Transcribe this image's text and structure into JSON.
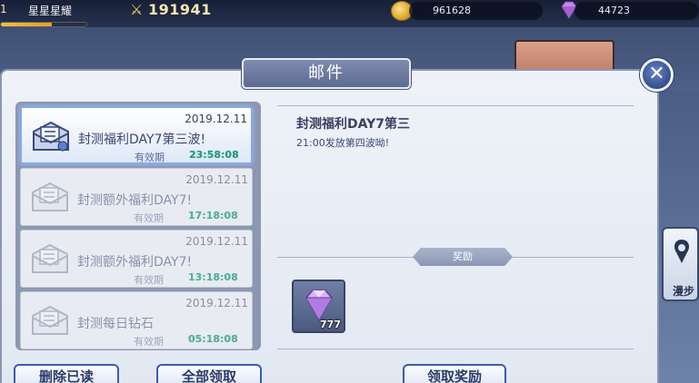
{
  "hud": {
    "level": "1",
    "player_name": "星星星耀",
    "exp_fraction": 0.6,
    "power_icon": "crossed-swords-icon",
    "power": "191941",
    "gold": "961628",
    "gems": "44723"
  },
  "side": {
    "button_label": "漫步"
  },
  "mail": {
    "title": "邮件",
    "items": [
      {
        "date": "2019.12.11",
        "subject": "封测福利DAY7第三波!",
        "valid_label": "有效期",
        "timer": "23:58:08",
        "active": true
      },
      {
        "date": "2019.12.11",
        "subject": "封测额外福利DAY7!",
        "valid_label": "有效期",
        "timer": "17:18:08",
        "active": false
      },
      {
        "date": "2019.12.11",
        "subject": "封测额外福利DAY7!",
        "valid_label": "有效期",
        "timer": "13:18:08",
        "active": false
      },
      {
        "date": "2019.12.11",
        "subject": "封测每日钻石",
        "valid_label": "有效期",
        "timer": "05:18:08",
        "active": false
      }
    ],
    "detail": {
      "title": "封测福利DAY7第三",
      "body": "21:00发放第四波呦!",
      "reward_label": "奖励",
      "reward": {
        "icon": "diamond-icon",
        "quantity": "777"
      }
    },
    "buttons": {
      "delete_read": "删除已读",
      "claim_all": "全部领取",
      "claim_reward": "领取奖励"
    }
  },
  "colors": {
    "accent": "#3a5cab",
    "timer": "#2f8f7a",
    "panel": "#e2e8f2"
  }
}
